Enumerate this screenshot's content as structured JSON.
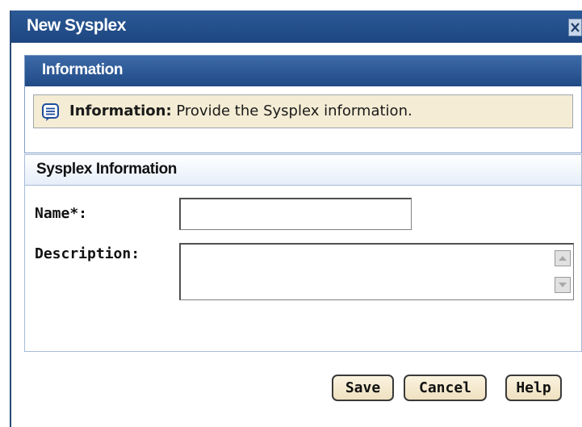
{
  "dialog": {
    "title": "New Sysplex"
  },
  "information_panel": {
    "header": "Information",
    "message_label": "Information:",
    "message_text": " Provide the Sysplex information."
  },
  "sysplex_panel": {
    "header": "Sysplex Information",
    "name_label": "Name*:",
    "name_value": "",
    "description_label": "Description:",
    "description_value": ""
  },
  "buttons": {
    "save": "Save",
    "cancel": "Cancel",
    "help": "Help"
  },
  "icons": {
    "close": "close-icon",
    "info": "info-message-icon",
    "scroll_up": "scroll-up-arrow-icon",
    "scroll_down": "scroll-down-arrow-icon"
  },
  "colors": {
    "title_bar": "#1d4680",
    "panel_header": "#2b5a97",
    "message_background": "#f4ecd4",
    "form_background": "#e4ecf8",
    "button_background": "#f4e8cc"
  }
}
